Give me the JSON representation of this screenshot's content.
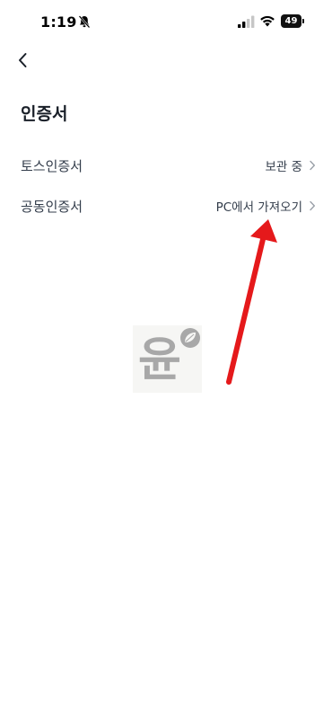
{
  "status_bar": {
    "time": "1:19",
    "battery": "49"
  },
  "page": {
    "title": "인증서"
  },
  "rows": [
    {
      "label": "토스인증서",
      "value": "보관 중"
    },
    {
      "label": "공동인증서",
      "value": "PC에서 가져오기"
    }
  ],
  "logo": {
    "char": "윤"
  },
  "colors": {
    "annotation_arrow": "#e5191b",
    "text": "#333d4b",
    "chevron": "#b0b8c1"
  }
}
